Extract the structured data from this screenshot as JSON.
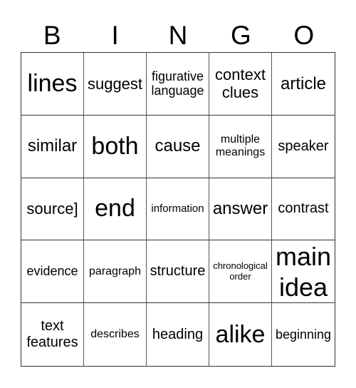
{
  "header": {
    "letters": [
      "B",
      "I",
      "N",
      "G",
      "O"
    ]
  },
  "board": {
    "rows": [
      [
        "lines",
        "suggest",
        "figurative\nlanguage",
        "context\nclues",
        "article"
      ],
      [
        "similar",
        "both",
        "cause",
        "multiple\nmeanings",
        "speaker"
      ],
      [
        "source]",
        "end",
        "information",
        "answer",
        "contrast"
      ],
      [
        "evidence",
        "paragraph",
        "structure",
        "chronological\norder",
        "main\nidea"
      ],
      [
        "text\nfeatures",
        "describes",
        "heading",
        "alike",
        "beginning"
      ]
    ]
  }
}
